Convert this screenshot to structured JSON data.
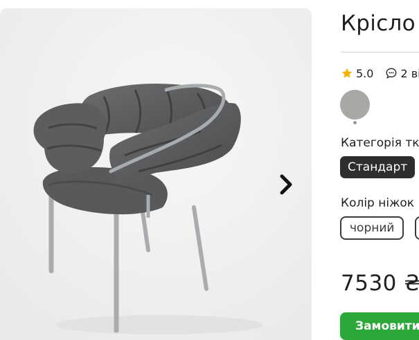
{
  "product": {
    "title": "Крісло",
    "rating": "5.0",
    "reviews": "2 ві",
    "color_swatch": "#a7a9a4",
    "category_label": "Категорія тк",
    "category_selected": "Стандарт",
    "leg_color_label": "Колір ніжок",
    "leg_color_selected": "чорний",
    "price": "7530 ₴",
    "order_button": "Замовити"
  },
  "icons": {
    "star": "star-icon",
    "comment": "comment-icon",
    "next": "chevron-right-icon"
  },
  "colors": {
    "accent_green": "#2ba838",
    "star_yellow": "#f5b301",
    "chip_dark": "#2e2e2e"
  }
}
